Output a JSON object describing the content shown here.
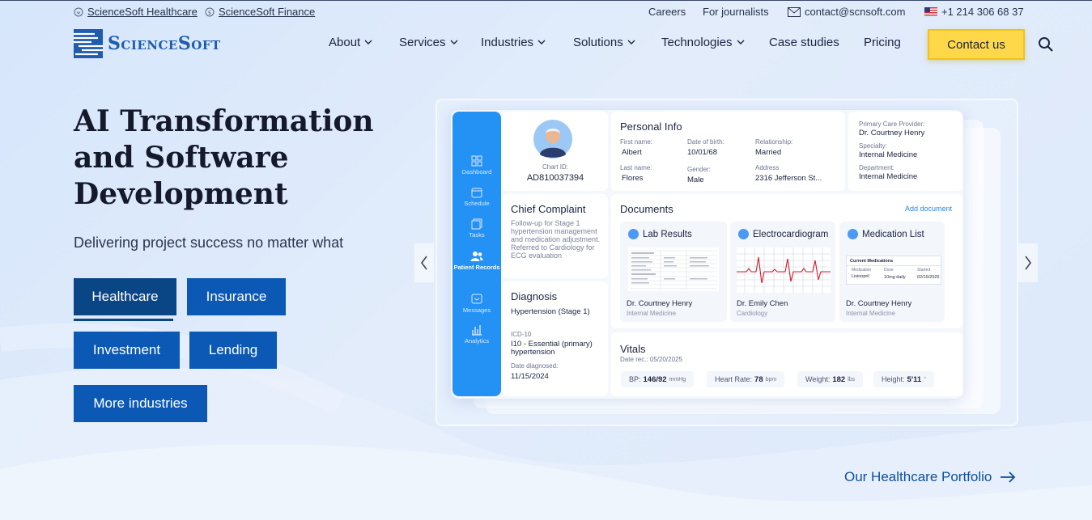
{
  "topbar": {
    "healthcare_link": "ScienceSoft Healthcare",
    "finance_link": "ScienceSoft Finance",
    "careers": "Careers",
    "journalists": "For journalists",
    "email": "contact@scnsoft.com",
    "phone": "+1 214 306 68 37"
  },
  "header": {
    "logo_text": "ScienceSoft",
    "nav": {
      "about": "About",
      "services": "Services",
      "industries": "Industries",
      "solutions": "Solutions",
      "technologies": "Technologies",
      "case_studies": "Case studies",
      "pricing": "Pricing"
    },
    "contact_label": "Contact us"
  },
  "hero": {
    "title": "AI Transformation and Software Development",
    "subtitle": "Delivering project success no matter what",
    "industries": {
      "healthcare": "Healthcare",
      "insurance": "Insurance",
      "investment": "Investment",
      "lending": "Lending",
      "more": "More industries"
    },
    "portfolio_link": "Our Healthcare Portfolio"
  },
  "dashboard": {
    "sidebar": {
      "dashboard": "Dashboard",
      "schedule": "Schedule",
      "tasks": "Tasks",
      "patient_records": "Patient Records",
      "messages": "Messages",
      "analytics": "Analytics"
    },
    "patient": {
      "chart_id_label": "Chart ID:",
      "chart_id": "AD810037394"
    },
    "personal_info": {
      "title": "Personal Info",
      "first_name_label": "First name:",
      "first_name": "Albert",
      "dob_label": "Date of birth:",
      "dob": "10/01/68",
      "relationship_label": "Relationship:",
      "relationship": "Married",
      "last_name_label": "Last name:",
      "last_name": "Flores",
      "gender_label": "Gender:",
      "gender": "Male",
      "address_label": "Address",
      "address": "2316 Jefferson St..."
    },
    "provider": {
      "pcp_label": "Primary Care Provider:",
      "pcp": "Dr. Courtney Henry",
      "specialty_label": "Specialty:",
      "specialty": "Internal Medicine",
      "department_label": "Department:",
      "department": "Internal Medicine"
    },
    "complaint": {
      "title": "Chief Complaint",
      "text": "Follow-up for Stage 1 hypertension management and medication adjustment. Referred to Cardiology for ECG evaluation"
    },
    "diagnosis": {
      "title": "Diagnosis",
      "name": "Hypertension (Stage 1)",
      "icd_label": "ICD-10",
      "icd": "I10 - Essential (primary) hypertension",
      "date_label": "Date diagnosed:",
      "date": "11/15/2024"
    },
    "documents": {
      "title": "Documents",
      "add": "Add document",
      "items": [
        {
          "title": "Lab Results",
          "doctor": "Dr. Courtney Henry",
          "specialty": "Internal Medicine"
        },
        {
          "title": "Electrocardiogram",
          "doctor": "Dr. Emily Chen",
          "specialty": "Cardiology"
        },
        {
          "title": "Medication List",
          "doctor": "Dr. Courtney Henry",
          "specialty": "Internal Medicine"
        }
      ],
      "med_list": {
        "heading": "Current Medications",
        "col_medication": "Medication",
        "col_dose": "Dose",
        "col_started": "Started",
        "medication": "Lisinopril",
        "dose": "10mg daily",
        "started": "02/15/2025"
      }
    },
    "vitals": {
      "title": "Vitals",
      "date": "Date rec.: 05/20/2025",
      "bp_label": "BP:",
      "bp": "146/92",
      "bp_unit": "mmHg",
      "hr_label": "Heart Rate:",
      "hr": "78",
      "hr_unit": "bpm",
      "weight_label": "Weight:",
      "weight": "182",
      "weight_unit": "lbs",
      "height_label": "Height:",
      "height": "5'11",
      "height_unit": "''"
    }
  }
}
